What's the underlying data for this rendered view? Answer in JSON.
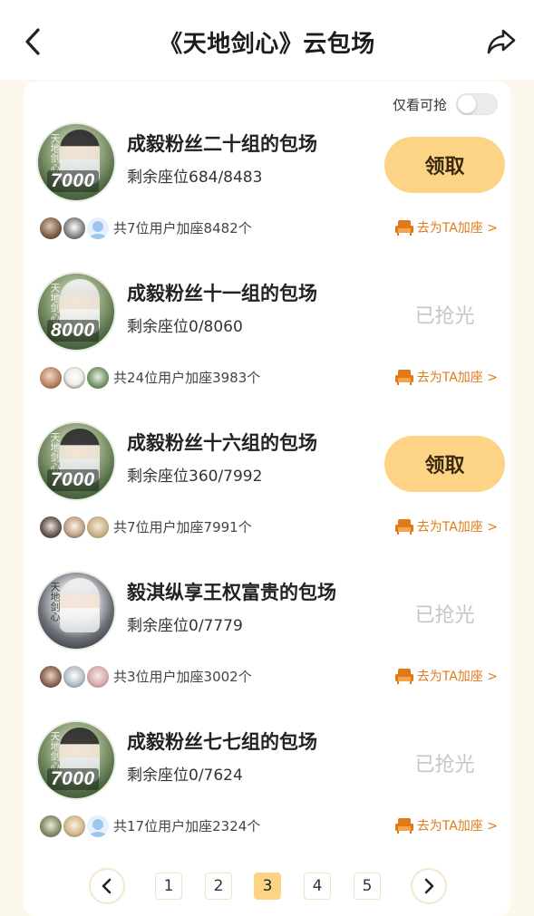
{
  "header": {
    "title": "《天地剑心》云包场"
  },
  "filter": {
    "label": "仅看可抢",
    "enabled": false
  },
  "sessions": [
    {
      "name": "成毅粉丝二十组的包场",
      "seats": "剩余座位684/8483",
      "poster_price": "7000",
      "status": "claimable",
      "action_label": "领取",
      "users": "共7位用户加座8482个",
      "add_seat_label": "去为TA加座 >"
    },
    {
      "name": "成毅粉丝十一组的包场",
      "seats": "剩余座位0/8060",
      "poster_price": "8000",
      "status": "sold_out",
      "action_label": "已抢光",
      "users": "共24位用户加座3983个",
      "add_seat_label": "去为TA加座 >"
    },
    {
      "name": "成毅粉丝十六组的包场",
      "seats": "剩余座位360/7992",
      "poster_price": "7000",
      "status": "claimable",
      "action_label": "领取",
      "users": "共7位用户加座7991个",
      "add_seat_label": "去为TA加座 >"
    },
    {
      "name": "毅淇纵享王权富贵的包场",
      "seats": "剩余座位0/7779",
      "poster_price": "",
      "status": "sold_out",
      "action_label": "已抢光",
      "users": "共3位用户加座3002个",
      "add_seat_label": "去为TA加座 >"
    },
    {
      "name": "成毅粉丝七七组的包场",
      "seats": "剩余座位0/7624",
      "poster_price": "7000",
      "status": "sold_out",
      "action_label": "已抢光",
      "users": "共17位用户加座2324个",
      "add_seat_label": "去为TA加座 >"
    }
  ],
  "pagination": {
    "pages": [
      "1",
      "2",
      "3",
      "4",
      "5"
    ],
    "current": "3"
  },
  "colors": {
    "accent": "#fdd385",
    "add_seat": "#e07a18",
    "sold_out": "#c6c6c6",
    "page_bg": "#fdf8ec"
  },
  "icons": {
    "back": "chevron-left",
    "share": "share-arrow",
    "seat": "sofa-seat",
    "prev": "chevron-left",
    "next": "chevron-right"
  }
}
